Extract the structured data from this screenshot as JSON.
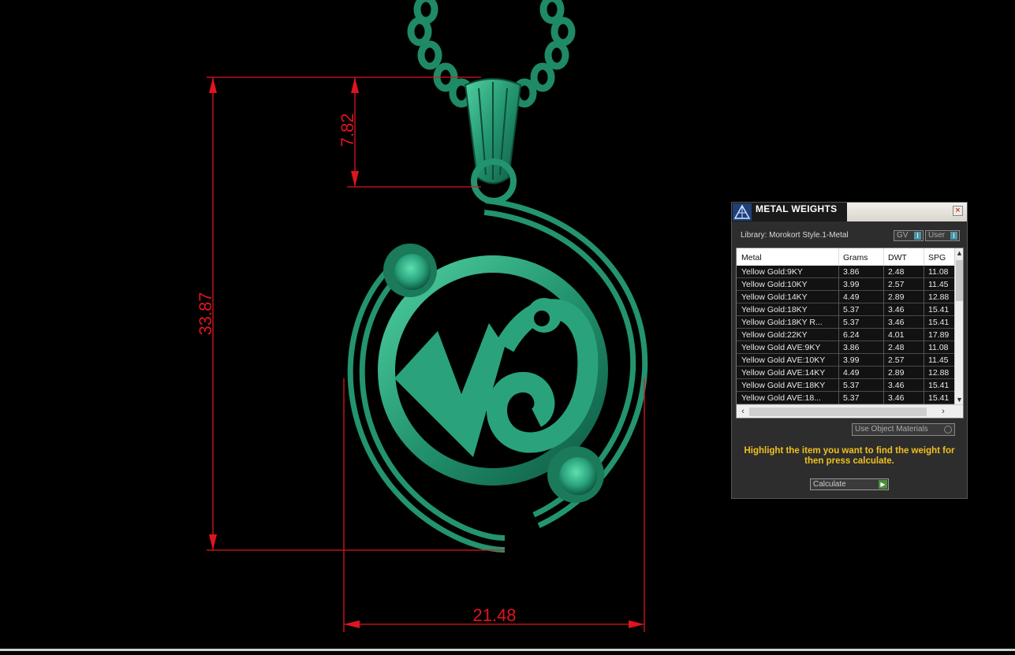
{
  "dimensions": {
    "height_top": "7.82",
    "height_total": "33.87",
    "width": "21.48"
  },
  "colors": {
    "pendant": "#2aa37c",
    "dimension_lines": "#e0141e"
  },
  "panel": {
    "title": "METAL WEIGHTS",
    "close_icon": "×",
    "library": "Library: Morokort Style.1-Metal",
    "gv_label": "GV",
    "user_label": "User",
    "columns": [
      "Metal",
      "Grams",
      "DWT",
      "SPG"
    ],
    "rows": [
      {
        "metal": "Yellow Gold:9KY",
        "grams": "3.86",
        "dwt": "2.48",
        "spg": "11.08"
      },
      {
        "metal": "Yellow Gold:10KY",
        "grams": "3.99",
        "dwt": "2.57",
        "spg": "11.45"
      },
      {
        "metal": "Yellow Gold:14KY",
        "grams": "4.49",
        "dwt": "2.89",
        "spg": "12.88"
      },
      {
        "metal": "Yellow Gold:18KY",
        "grams": "5.37",
        "dwt": "3.46",
        "spg": "15.41"
      },
      {
        "metal": "Yellow Gold:18KY R...",
        "grams": "5.37",
        "dwt": "3.46",
        "spg": "15.41"
      },
      {
        "metal": "Yellow Gold:22KY",
        "grams": "6.24",
        "dwt": "4.01",
        "spg": "17.89"
      },
      {
        "metal": "Yellow Gold AVE:9KY",
        "grams": "3.86",
        "dwt": "2.48",
        "spg": "11.08"
      },
      {
        "metal": "Yellow Gold AVE:10KY",
        "grams": "3.99",
        "dwt": "2.57",
        "spg": "11.45"
      },
      {
        "metal": "Yellow Gold AVE:14KY",
        "grams": "4.49",
        "dwt": "2.89",
        "spg": "12.88"
      },
      {
        "metal": "Yellow Gold AVE:18KY",
        "grams": "5.37",
        "dwt": "3.46",
        "spg": "15.41"
      },
      {
        "metal": "Yellow Gold AVE:18...",
        "grams": "5.37",
        "dwt": "3.46",
        "spg": "15.41"
      }
    ],
    "use_object_materials": "Use Object Materials",
    "hint": "Highlight the item you want to find the weight for then press calculate.",
    "calculate_label": "Calculate"
  }
}
